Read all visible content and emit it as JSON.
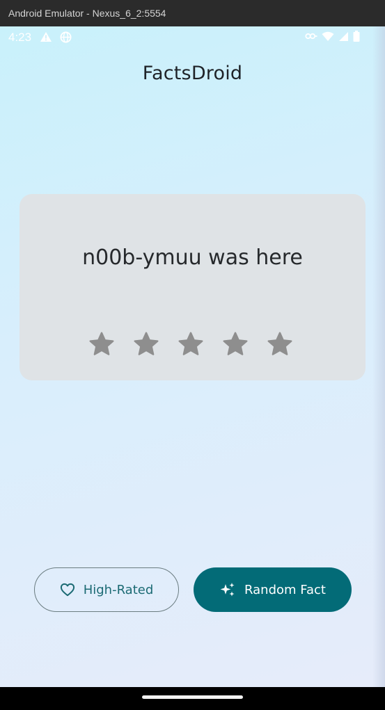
{
  "window": {
    "title": "Android Emulator - Nexus_6_2:5554"
  },
  "statusbar": {
    "time": "4:23",
    "icons": [
      "warning-icon",
      "globe-icon",
      "key-icon",
      "wifi-icon",
      "signal-icon",
      "battery-icon"
    ]
  },
  "app": {
    "title": "FactsDroid"
  },
  "fact": {
    "text": "n00b-ymuu was here",
    "rating": 0,
    "max_rating": 5
  },
  "buttons": {
    "high_rated_label": "High-Rated",
    "high_rated_icon": "heart-icon",
    "random_label": "Random Fact",
    "random_icon": "sparkles-icon"
  },
  "colors": {
    "accent": "#036b77",
    "star_inactive": "#8e8e8e",
    "card_bg": "#dfe3e6"
  }
}
